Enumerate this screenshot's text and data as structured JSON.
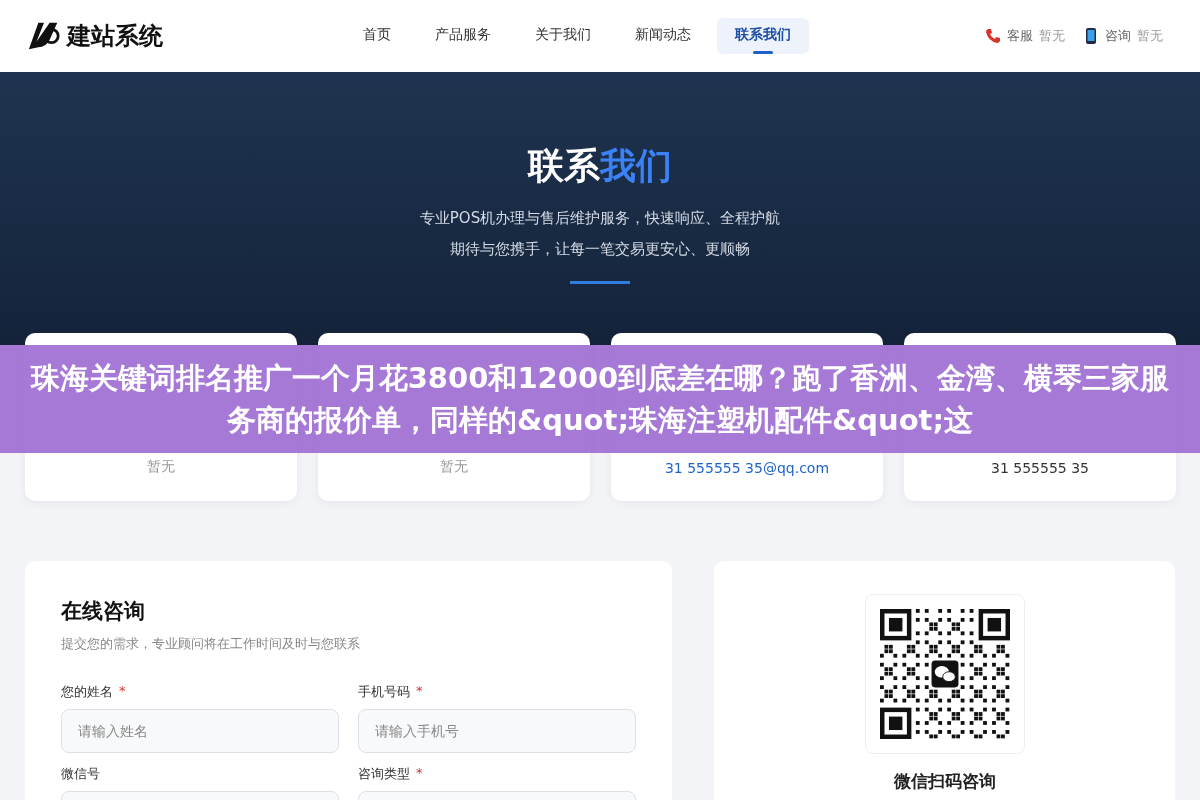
{
  "header": {
    "logo_text": "建站系统",
    "nav": [
      {
        "label": "首页",
        "selected": false
      },
      {
        "label": "产品服务",
        "selected": false
      },
      {
        "label": "关于我们",
        "selected": false
      },
      {
        "label": "新闻动态",
        "selected": false
      },
      {
        "label": "联系我们",
        "selected": true
      }
    ],
    "contacts": [
      {
        "kind": "phone",
        "label": "客服",
        "value": "暂无"
      },
      {
        "kind": "mobile",
        "label": "咨询",
        "value": "暂无"
      }
    ]
  },
  "hero": {
    "title_plain": "联系",
    "title_accent": "我们",
    "lines": [
      "专业POS机办理与售后维护服务，快速响应、全程护航",
      "期待与您携手，让每一笔交易更安心、更顺畅"
    ]
  },
  "cards": [
    {
      "value": "暂无",
      "kind": "muted"
    },
    {
      "value": "暂无",
      "kind": "muted"
    },
    {
      "value": "31 555555 35@qq.com",
      "kind": "link"
    },
    {
      "value": "31 555555 35",
      "kind": "plain"
    }
  ],
  "banner": {
    "text": "珠海关键词排名推广一个月花3800和12000到底差在哪？跑了香洲、金湾、横琴三家服务商的报价单，同样的&quot;珠海注塑机配件&quot;这"
  },
  "form": {
    "title": "在线咨询",
    "subtitle": "提交您的需求，专业顾问将在工作时间及时与您联系",
    "fields": [
      {
        "label": "您的姓名",
        "required_mark": "*",
        "placeholder": "请输入姓名"
      },
      {
        "label": "手机号码",
        "required_mark": "*",
        "placeholder": "请输入手机号"
      },
      {
        "label": "微信号"
      },
      {
        "label": "咨询类型",
        "required_mark": "*"
      }
    ]
  },
  "qr": {
    "title": "微信扫码咨询"
  }
}
